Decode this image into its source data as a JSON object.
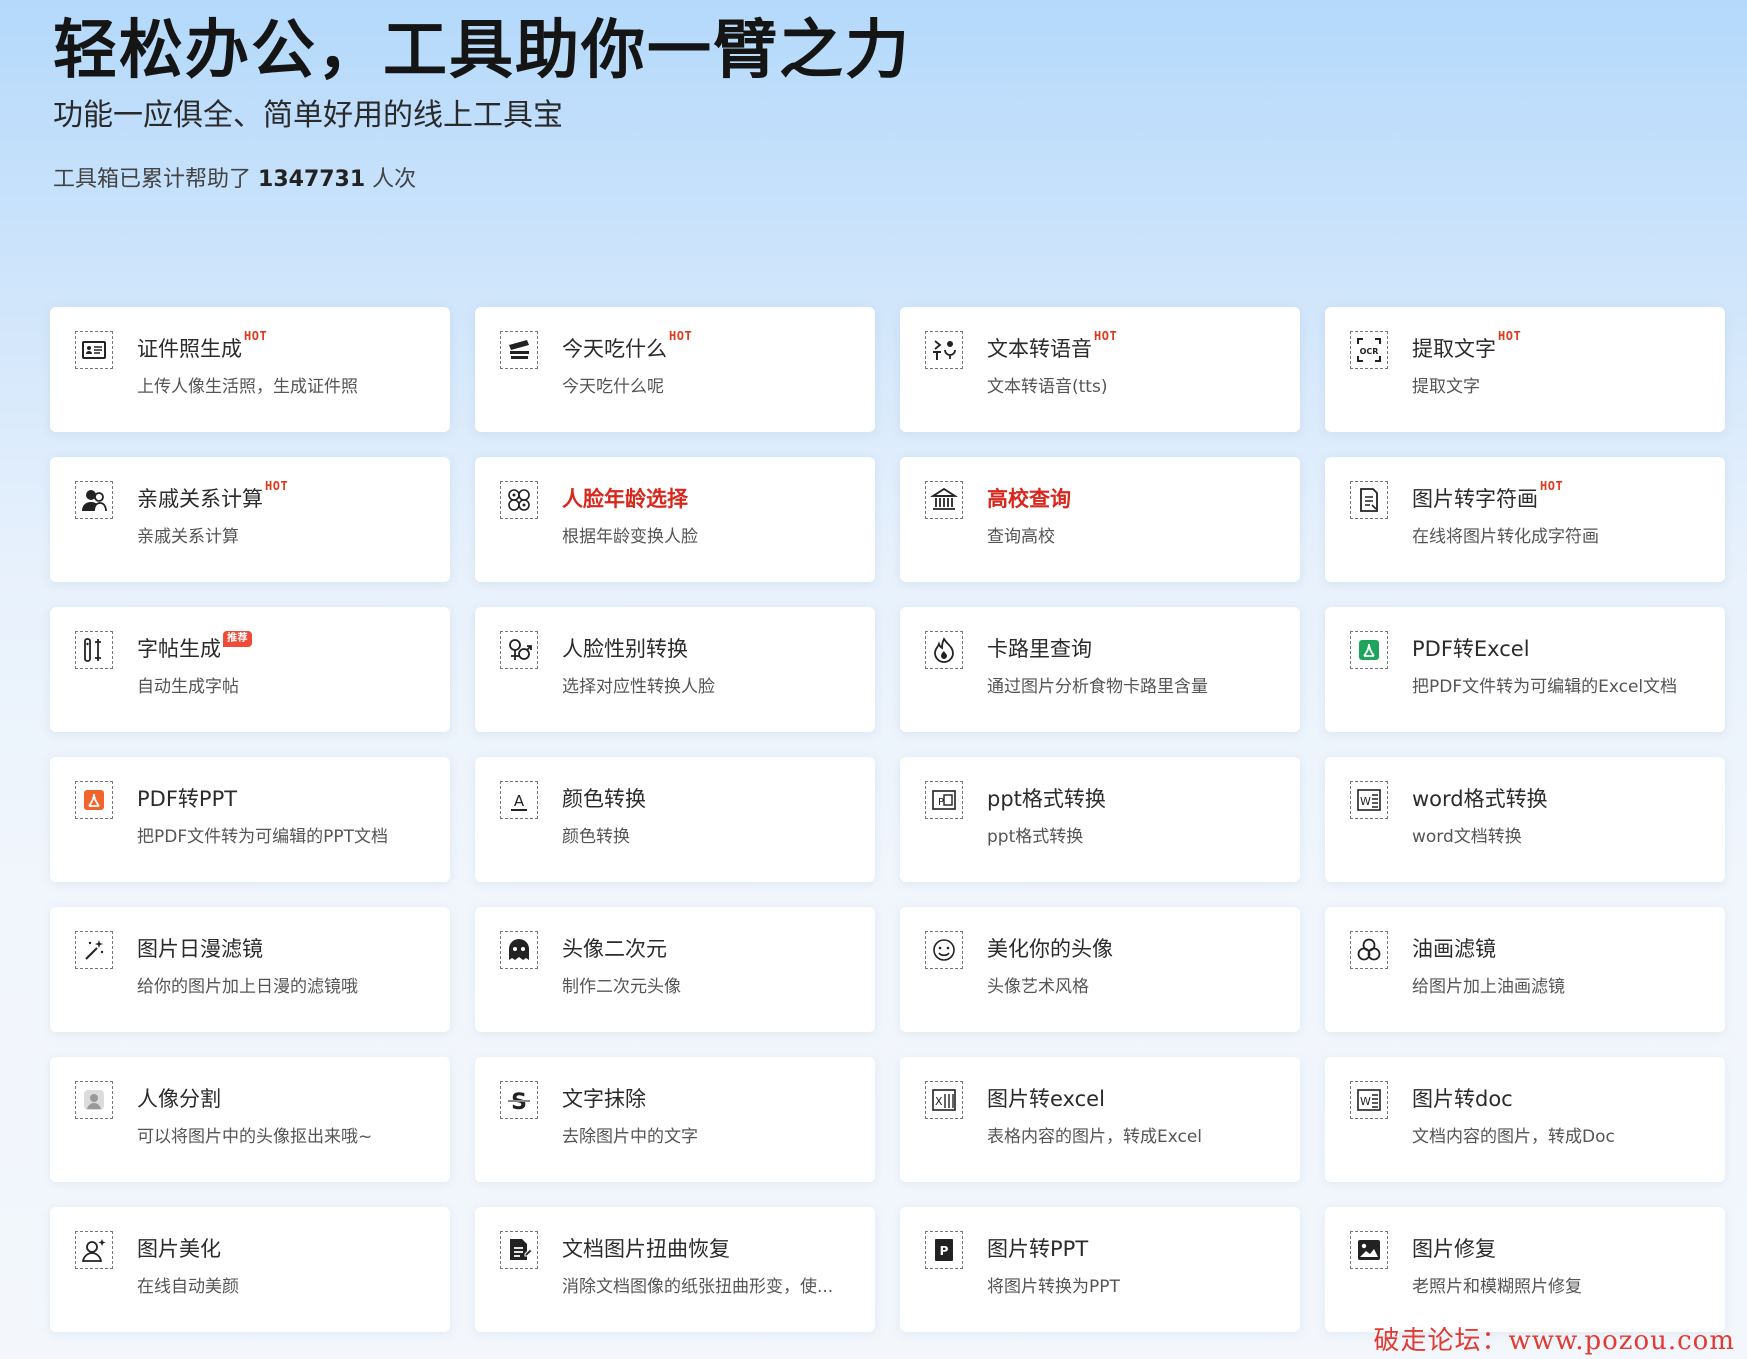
{
  "hero": {
    "title": "轻松办公，工具助你一臂之力",
    "subtitle": "功能一应俱全、简单好用的线上工具宝",
    "count_prefix": "工具箱已累计帮助了",
    "count_value": "1347731",
    "count_suffix": "人次"
  },
  "tools": [
    {
      "title": "证件照生成",
      "desc": "上传人像生活照，生成证件照",
      "badge": "HOT",
      "badge_type": "hot",
      "icon": "id-card-icon"
    },
    {
      "title": "今天吃什么",
      "desc": "今天吃什么呢",
      "badge": "HOT",
      "badge_type": "hot",
      "icon": "food-icon"
    },
    {
      "title": "文本转语音",
      "desc": "文本转语音(tts)",
      "badge": "HOT",
      "badge_type": "hot",
      "icon": "text-to-speech-icon"
    },
    {
      "title": "提取文字",
      "desc": "提取文字",
      "badge": "HOT",
      "badge_type": "hot",
      "icon": "ocr-icon"
    },
    {
      "title": "亲戚关系计算",
      "desc": "亲戚关系计算",
      "badge": "HOT",
      "badge_type": "hot",
      "icon": "relatives-icon"
    },
    {
      "title": "人脸年龄选择",
      "desc": "根据年龄变换人脸",
      "badge": "",
      "badge_type": "",
      "icon": "face-age-icon",
      "highlight": true
    },
    {
      "title": "高校查询",
      "desc": "查询高校",
      "badge": "",
      "badge_type": "",
      "icon": "university-icon",
      "highlight": true
    },
    {
      "title": "图片转字符画",
      "desc": "在线将图片转化成字符画",
      "badge": "HOT",
      "badge_type": "hot",
      "icon": "ascii-art-icon"
    },
    {
      "title": "字帖生成",
      "desc": "自动生成字帖",
      "badge": "推荐",
      "badge_type": "rec",
      "icon": "copybook-icon"
    },
    {
      "title": "人脸性别转换",
      "desc": "选择对应性转换人脸",
      "badge": "",
      "badge_type": "",
      "icon": "gender-icon"
    },
    {
      "title": "卡路里查询",
      "desc": "通过图片分析食物卡路里含量",
      "badge": "",
      "badge_type": "",
      "icon": "calorie-icon"
    },
    {
      "title": "PDF转Excel",
      "desc": "把PDF文件转为可编辑的Excel文档",
      "badge": "",
      "badge_type": "",
      "icon": "pdf-excel-icon"
    },
    {
      "title": "PDF转PPT",
      "desc": "把PDF文件转为可编辑的PPT文档",
      "badge": "",
      "badge_type": "",
      "icon": "pdf-ppt-icon"
    },
    {
      "title": "颜色转换",
      "desc": "颜色转换",
      "badge": "",
      "badge_type": "",
      "icon": "color-convert-icon"
    },
    {
      "title": "ppt格式转换",
      "desc": "ppt格式转换",
      "badge": "",
      "badge_type": "",
      "icon": "ppt-format-icon"
    },
    {
      "title": "word格式转换",
      "desc": "word文档转换",
      "badge": "",
      "badge_type": "",
      "icon": "word-format-icon"
    },
    {
      "title": "图片日漫滤镜",
      "desc": "给你的图片加上日漫的滤镜哦",
      "badge": "",
      "badge_type": "",
      "icon": "magic-wand-icon"
    },
    {
      "title": "头像二次元",
      "desc": "制作二次元头像",
      "badge": "",
      "badge_type": "",
      "icon": "anime-avatar-icon"
    },
    {
      "title": "美化你的头像",
      "desc": "头像艺术风格",
      "badge": "",
      "badge_type": "",
      "icon": "smile-face-icon"
    },
    {
      "title": "油画滤镜",
      "desc": "给图片加上油画滤镜",
      "badge": "",
      "badge_type": "",
      "icon": "oil-paint-icon"
    },
    {
      "title": "人像分割",
      "desc": "可以将图片中的头像抠出来哦~",
      "badge": "",
      "badge_type": "",
      "icon": "portrait-segment-icon"
    },
    {
      "title": "文字抹除",
      "desc": "去除图片中的文字",
      "badge": "",
      "badge_type": "",
      "icon": "text-erase-icon"
    },
    {
      "title": "图片转excel",
      "desc": "表格内容的图片，转成Excel",
      "badge": "",
      "badge_type": "",
      "icon": "image-excel-icon"
    },
    {
      "title": "图片转doc",
      "desc": "文档内容的图片，转成Doc",
      "badge": "",
      "badge_type": "",
      "icon": "image-doc-icon"
    },
    {
      "title": "图片美化",
      "desc": "在线自动美颜",
      "badge": "",
      "badge_type": "",
      "icon": "beautify-icon"
    },
    {
      "title": "文档图片扭曲恢复",
      "desc": "消除文档图像的纸张扭曲形变，使...",
      "badge": "",
      "badge_type": "",
      "icon": "doc-restore-icon"
    },
    {
      "title": "图片转PPT",
      "desc": "将图片转换为PPT",
      "badge": "",
      "badge_type": "",
      "icon": "image-ppt-icon"
    },
    {
      "title": "图片修复",
      "desc": "老照片和模糊照片修复",
      "badge": "",
      "badge_type": "",
      "icon": "photo-repair-icon"
    }
  ],
  "watermark": "破走论坛：www.pozou.com",
  "colors": {
    "highlight": "#d8281d",
    "hot_badge": "#e03a1e",
    "rec_badge": "#ef4b36"
  }
}
